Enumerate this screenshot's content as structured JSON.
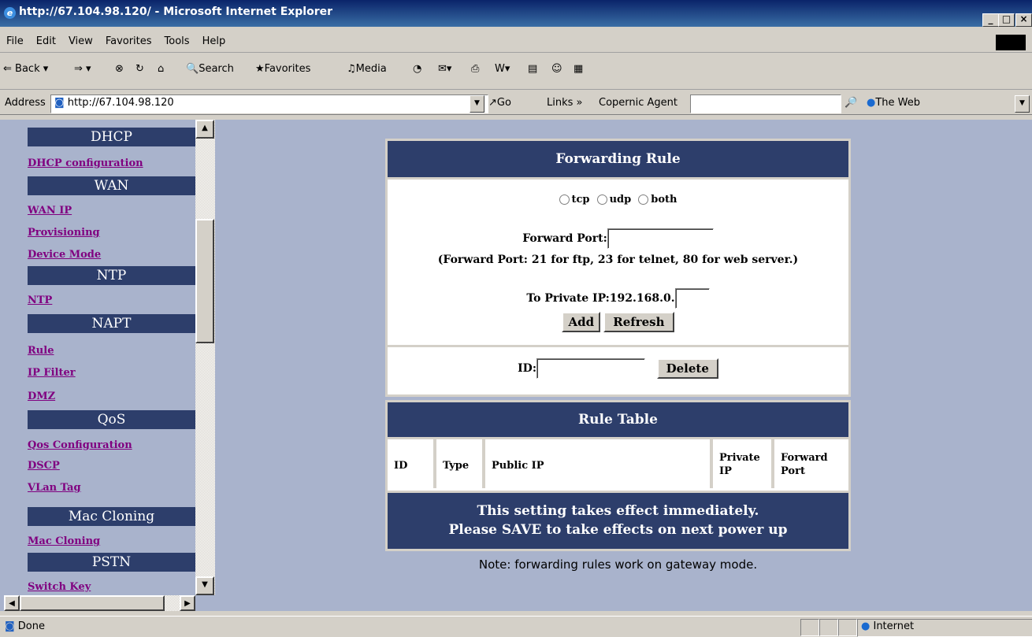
{
  "window": {
    "title": "http://67.104.98.120/ - Microsoft Internet Explorer"
  },
  "menu": [
    "File",
    "Edit",
    "View",
    "Favorites",
    "Tools",
    "Help"
  ],
  "toolbar": {
    "back": "Back",
    "search": "Search",
    "favorites": "Favorites",
    "media": "Media"
  },
  "address": {
    "label": "Address",
    "url": "http://67.104.98.120",
    "go": "Go",
    "links": "Links",
    "copernic": "Copernic Agent",
    "search_engine": "The Web"
  },
  "nav": {
    "sections": [
      {
        "header": "DHCP",
        "links": [
          "DHCP configuration"
        ]
      },
      {
        "header": "WAN",
        "links": [
          "WAN IP",
          "Provisioning",
          "Device Mode"
        ]
      },
      {
        "header": "NTP",
        "links": [
          "NTP"
        ]
      },
      {
        "header": "NAPT",
        "links": [
          "Rule",
          "IP Filter",
          "DMZ"
        ]
      },
      {
        "header": "QoS",
        "links": [
          "Qos Configuration",
          "DSCP",
          "VLan Tag"
        ]
      },
      {
        "header": "Mac Cloning",
        "links": [
          "Mac Cloning"
        ]
      },
      {
        "header": "PSTN",
        "links": [
          "Switch Key"
        ]
      }
    ]
  },
  "forwarding": {
    "title": "Forwarding Rule",
    "protocols": [
      "tcp",
      "udp",
      "both"
    ],
    "port_label": "Forward Port:",
    "port_hint": "(Forward Port: 21 for ftp, 23 for telnet, 80 for web server.)",
    "ip_label": "To Private IP:192.168.0.",
    "add": "Add",
    "refresh": "Refresh",
    "id_label": "ID:",
    "delete": "Delete"
  },
  "rule_table": {
    "title": "Rule Table",
    "columns": [
      "ID",
      "Type",
      "Public IP",
      "Private IP",
      "Forward Port"
    ],
    "footer_line1": "This setting takes effect immediately.",
    "footer_line2": "Please SAVE to take effects on next power up"
  },
  "note": "Note: forwarding rules work on gateway mode.",
  "status": {
    "left": "Done",
    "zone": "Internet"
  }
}
